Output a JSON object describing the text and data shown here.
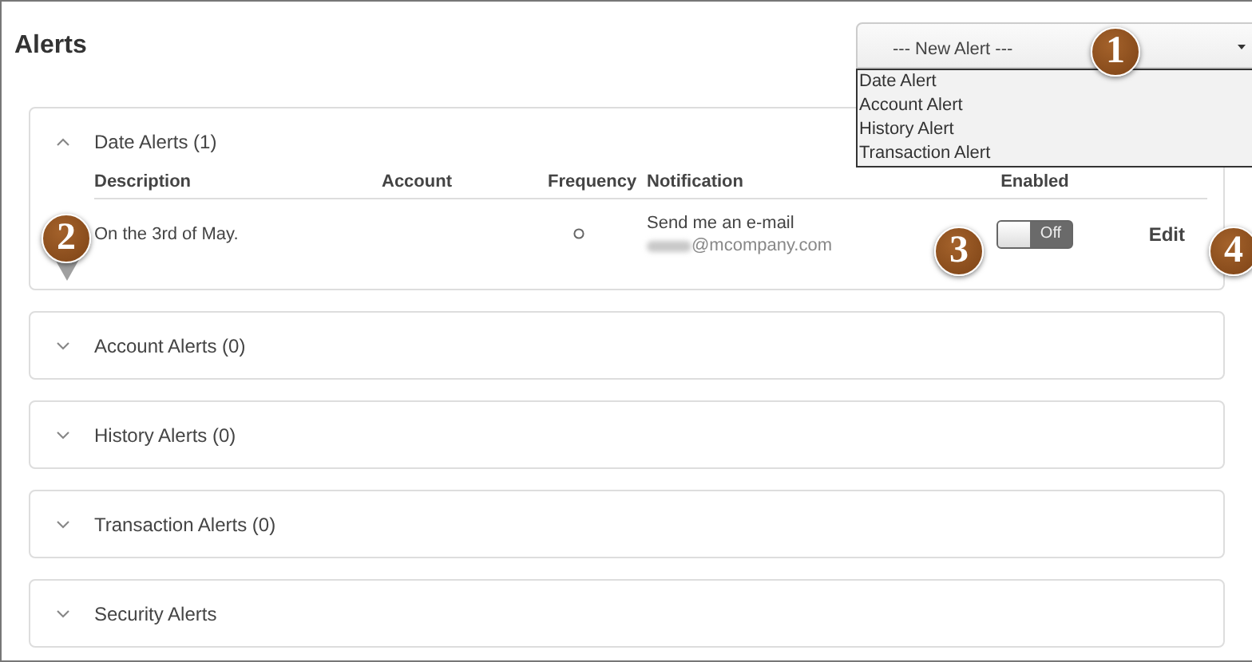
{
  "page": {
    "title": "Alerts"
  },
  "new_alert": {
    "value": "--- New Alert ---",
    "expanded": true,
    "options": [
      {
        "label": "Date Alert"
      },
      {
        "label": "Account Alert"
      },
      {
        "label": "History Alert"
      },
      {
        "label": "Transaction Alert"
      }
    ]
  },
  "sections": [
    {
      "title": "Date Alerts (1)",
      "expanded": true,
      "columns": [
        "Description",
        "Account",
        "Frequency",
        "Notification",
        "Enabled"
      ],
      "rows": [
        {
          "description": "On the 3rd of May.",
          "notification": "Send me an e-mail",
          "email": "@mcompany.com",
          "email_redacted": true,
          "enabled": {
            "on": false,
            "label": "Off"
          },
          "action": "Edit"
        }
      ]
    },
    {
      "title": "Account Alerts (0)",
      "expanded": false
    },
    {
      "title": "History Alerts (0)",
      "expanded": false
    },
    {
      "title": "Transaction Alerts (0)",
      "expanded": false
    },
    {
      "title": "Security Alerts",
      "expanded": false
    }
  ],
  "callouts": [
    {
      "number": "1",
      "kind": "circle"
    },
    {
      "number": "2",
      "kind": "pin"
    },
    {
      "number": "3",
      "kind": "circle"
    },
    {
      "number": "4",
      "kind": "circle"
    }
  ]
}
